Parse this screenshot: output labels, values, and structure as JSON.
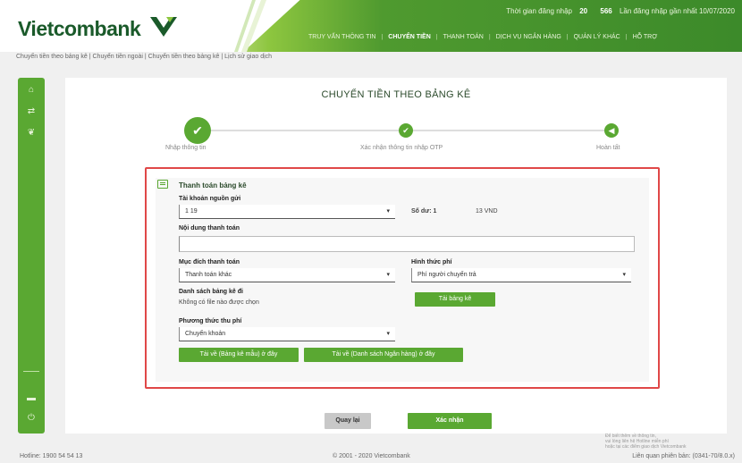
{
  "header": {
    "logo_text": "Vietcombank",
    "user_line": [
      "Thời gian đăng nhập",
      "Lần đăng nhập gần nhất",
      "10/07/2020"
    ],
    "user_bold": [
      "20",
      "566"
    ],
    "nav": [
      "TRUY VẤN THÔNG TIN",
      "CHUYỂN TIỀN",
      "THANH TOÁN",
      "DỊCH VỤ NGÂN HÀNG",
      "QUẢN LÝ KHÁC",
      "HỖ TRỢ"
    ]
  },
  "subnav": "Chuyển tiền theo bảng kê | Chuyển tiền ngoài | Chuyển tiền theo bảng kê | Lịch sử giao dịch",
  "page": {
    "title": "CHUYỂN TIỀN THEO BẢNG KÊ",
    "steps": [
      "Nhập thông tin",
      "Xác nhận thông tin nhập OTP",
      "Hoàn tất"
    ],
    "step_icons": {
      "done": "✔",
      "mid": "✔",
      "last": "◀"
    }
  },
  "form": {
    "section_title": "Thanh toán bảng kê",
    "account_label": "Tài khoản nguồn gửi",
    "account_value": "1          19",
    "balance_label": "Số dư: 1",
    "balance_value": "13 VND",
    "content_label": "Nội dung thanh toán",
    "content_value": "",
    "purpose_label": "Mục đích thanh toán",
    "purpose_value": "Thanh toán khác",
    "method_label": "Hình thức phí",
    "method_value": "Phí người chuyển trả",
    "list_label": "Danh sách bảng kê đi",
    "list_note": "Không có file nào được chọn",
    "upload_label": "Tải bảng kê",
    "fee_label": "Phương thức thu phí",
    "fee_value": "Chuyển khoản",
    "dl_template": "Tải về (Bảng kê mẫu) ở đây",
    "dl_banks": "Tải về (Danh sách Ngân hàng) ở đây"
  },
  "actions": {
    "back": "Quay lại",
    "confirm": "Xác nhận"
  },
  "side_note": [
    "Để biết thêm về thông tin,",
    "vui lòng liên hệ Hotline miễn phí",
    "hoặc tại các điểm giao dịch Vietcombank"
  ],
  "footer": {
    "left": "Hotline: 1900 54 54 13",
    "center": "© 2001 - 2020 Vietcombank",
    "right": "Liên quan phiên bản: (0341-70/8.0.x)"
  },
  "colors": {
    "brand_green": "#5aa832",
    "dark_green": "#1a5a2a",
    "highlight_red": "#e04848"
  },
  "icons": [
    "home-icon",
    "transfer-icon",
    "leaf-icon",
    "flag-icon",
    "power-icon",
    "doc-icon"
  ]
}
